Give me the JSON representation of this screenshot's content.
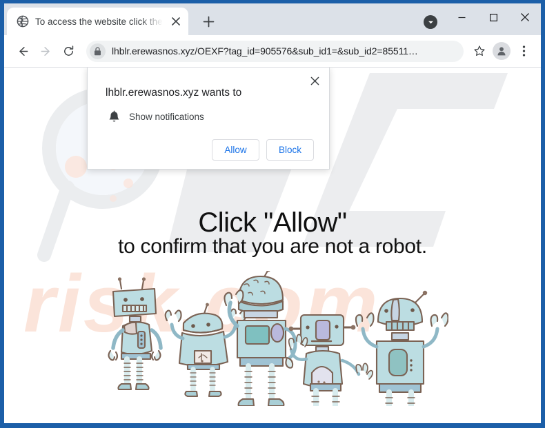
{
  "window": {
    "frame_color": "#1c5fa8",
    "controls": {
      "tab_search": "tab-search-chevron",
      "minimize": "–",
      "maximize": "☐",
      "close": "✕"
    }
  },
  "tabstrip": {
    "tab": {
      "favicon": "globe-icon",
      "title": "To access the website click the \"A",
      "close_label": "✕"
    },
    "new_tab_label": "+"
  },
  "toolbar": {
    "back_label": "←",
    "forward_label": "→",
    "reload_label": "⟳",
    "lock_icon": "lock-icon",
    "url": "lhblr.erewasnos.xyz/OEXF?tag_id=905576&sub_id1=&sub_id2=85511…",
    "bookmark_icon": "star-icon",
    "profile_icon": "person-icon",
    "menu_icon": "three-dots-icon"
  },
  "permission_dialog": {
    "title": "lhblr.erewasnos.xyz wants to",
    "close_label": "✕",
    "permission_icon": "bell-icon",
    "permission_label": "Show notifications",
    "allow_label": "Allow",
    "block_label": "Block",
    "accent_color": "#1a73e8"
  },
  "page": {
    "heading": "Click \"Allow\"",
    "subheading": "to confirm that you are not a robot.",
    "illustration": "five-cartoon-robots",
    "watermark_text": "PCrisk.com",
    "watermark_color": "#eceef0",
    "watermark_accent": "#fbe6dd",
    "background": "#ffffff"
  }
}
